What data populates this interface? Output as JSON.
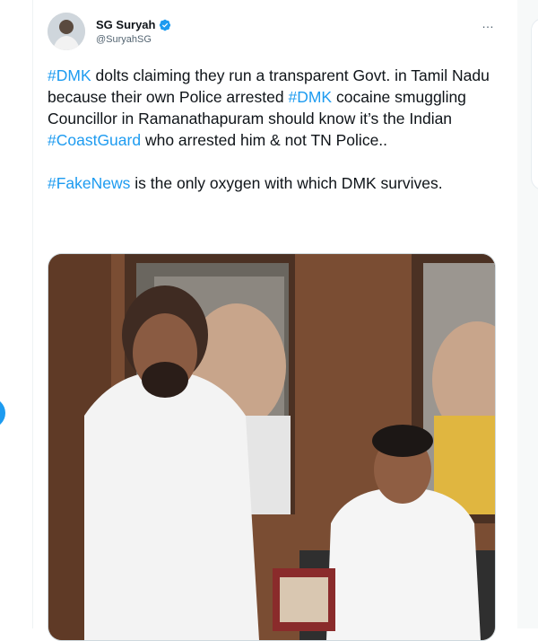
{
  "tweet": {
    "display_name": "SG Suryah",
    "handle": "@SuryahSG",
    "more_icon": "…",
    "para1": [
      {
        "text": "#DMK",
        "tag": true
      },
      {
        "text": " dolts claiming they run a transparent Govt. in Tamil Nadu because their own Police arrested ",
        "tag": false
      },
      {
        "text": "#DMK",
        "tag": true
      },
      {
        "text": " cocaine smuggling Councillor in Ramanathapuram should know it’s the Indian ",
        "tag": false
      },
      {
        "text": "#CoastGuard",
        "tag": true
      },
      {
        "text": " who arrested him & not TN Police..",
        "tag": false
      }
    ],
    "para2": [
      {
        "text": "#FakeNews",
        "tag": true
      },
      {
        "text": " is the only oxygen with which DMK survives.",
        "tag": false
      }
    ]
  },
  "colors": {
    "link": "#1d9bf0",
    "text": "#0f1419",
    "muted": "#536471",
    "accent": "#1d9bf0"
  },
  "icons": {
    "verified": "verified-badge-icon",
    "more": "more-options-icon"
  }
}
